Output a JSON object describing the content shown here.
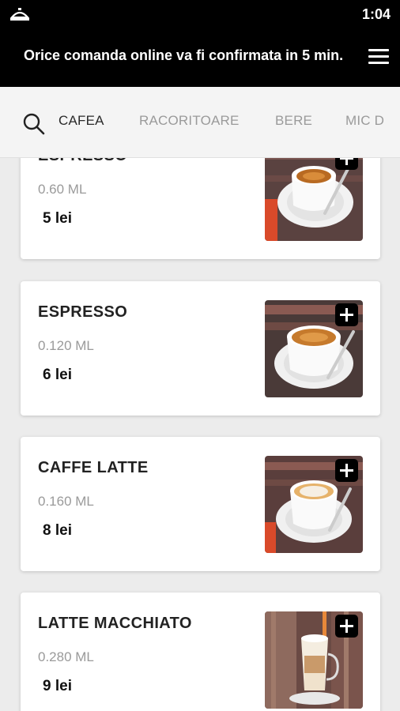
{
  "status_bar": {
    "time": "1:04",
    "app_icon": "cloche-icon"
  },
  "header": {
    "notice": "Orice comanda online va fi confirmata in 5 min.",
    "menu_icon": "hamburger-menu-icon"
  },
  "tabs": {
    "search_icon": "search-icon",
    "items": [
      {
        "label": "CAFEA",
        "active": true
      },
      {
        "label": "RACORITOARE",
        "active": false
      },
      {
        "label": "BERE",
        "active": false
      },
      {
        "label": "MIC D",
        "active": false
      }
    ]
  },
  "products": [
    {
      "name": "ESPRESSO",
      "volume": "0.60 ML",
      "price": "5 lei",
      "add_icon": "plus-icon",
      "image": "espresso-cup-photo"
    },
    {
      "name": "ESPRESSO",
      "volume": "0.120 ML",
      "price": "6 lei",
      "add_icon": "plus-icon",
      "image": "double-espresso-cup-photo"
    },
    {
      "name": "CAFFE LATTE",
      "volume": "0.160 ML",
      "price": "8 lei",
      "add_icon": "plus-icon",
      "image": "caffe-latte-cup-photo"
    },
    {
      "name": "LATTE MACCHIATO",
      "volume": "0.280 ML",
      "price": "9 lei",
      "add_icon": "plus-icon",
      "image": "latte-macchiato-glass-photo"
    }
  ],
  "colors": {
    "header_bg": "#000000",
    "tabs_bg": "#f4f4f4",
    "page_bg": "#ececec",
    "active_tab": "#2a2a2a",
    "inactive_tab": "#9a9a9a"
  }
}
